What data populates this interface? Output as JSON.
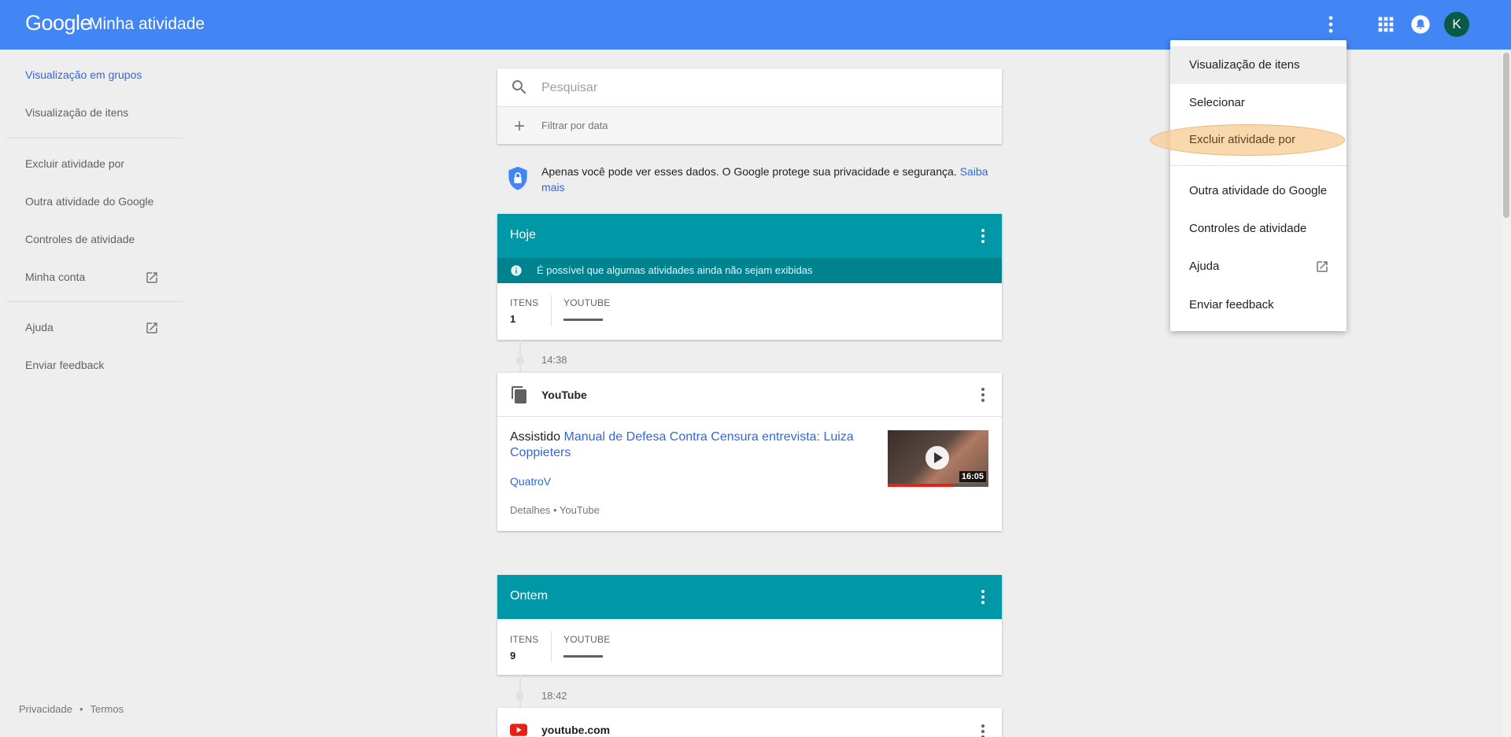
{
  "header": {
    "logo": "Google",
    "title": "Minha atividade",
    "avatar_letter": "K"
  },
  "leftnav": {
    "items": [
      {
        "label": "Visualização em grupos"
      },
      {
        "label": "Visualização de itens"
      },
      {
        "label": "Excluir atividade por"
      },
      {
        "label": "Outra atividade do Google"
      },
      {
        "label": "Controles de atividade"
      },
      {
        "label": "Minha conta"
      },
      {
        "label": "Ajuda"
      },
      {
        "label": "Enviar feedback"
      }
    ]
  },
  "footer": {
    "privacy": "Privacidade",
    "separator": "•",
    "terms": "Termos"
  },
  "search": {
    "placeholder": "Pesquisar",
    "filter_label": "Filtrar por data"
  },
  "privacy_notice": {
    "text": "Apenas você pode ver esses dados. O Google protege sua privacidade e segurança.",
    "link": "Saiba mais"
  },
  "groups": [
    {
      "title": "Hoje",
      "notice": "É possível que algumas atividades ainda não sejam exibidas",
      "items_label": "ITENS",
      "items_count": "1",
      "product_label": "YOUTUBE",
      "time": "14:38",
      "entry": {
        "title": "YouTube",
        "action": "Assistido",
        "video_title": "Manual de Defesa Contra Censura entrevista: Luiza Coppieters",
        "channel": "QuatroV",
        "details": "Detalhes",
        "details_sep": "•",
        "details_source": "YouTube",
        "duration": "16:05",
        "watched_fraction": 0.65
      }
    },
    {
      "title": "Ontem",
      "items_label": "ITENS",
      "items_count": "9",
      "product_label": "YOUTUBE",
      "time": "18:42",
      "entry": {
        "title": "youtube.com"
      }
    }
  ],
  "menu": {
    "items": [
      {
        "label": "Visualização de itens"
      },
      {
        "label": "Selecionar"
      },
      {
        "label": "Excluir atividade por"
      },
      {
        "label": "Outra atividade do Google"
      },
      {
        "label": "Controles de atividade"
      },
      {
        "label": "Ajuda"
      },
      {
        "label": "Enviar feedback"
      }
    ]
  },
  "colors": {
    "header_bg": "#4285f4",
    "day_header_bg": "#0097a7",
    "notice_bg": "#00838f",
    "link": "#3367d6",
    "highlight": "#f7cb92"
  }
}
